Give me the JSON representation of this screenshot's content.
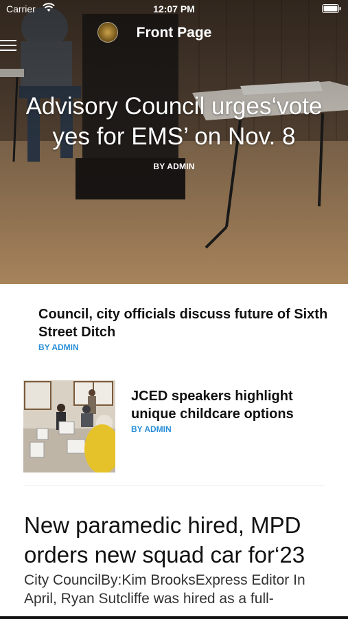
{
  "status_bar": {
    "carrier": "Carrier",
    "time": "12:07 PM"
  },
  "nav": {
    "title": "Front Page"
  },
  "hero": {
    "headline": "Advisory Council urges‘vote yes for EMS’ on Nov. 8",
    "byline": "BY ADMIN"
  },
  "articles": [
    {
      "title": "Council, city officials discuss future of Sixth Street Ditch",
      "byline": "BY ADMIN"
    },
    {
      "title": "JCED speakers highlight unique childcare options",
      "byline": "BY ADMIN"
    },
    {
      "title": "New paramedic hired, MPD orders new squad car for‘23",
      "excerpt": "City CouncilBy:Kim BrooksExpress Editor In April, Ryan Sutcliffe was hired as a full-"
    }
  ],
  "colors": {
    "byline_accent": "#2a8fd8",
    "text": "#111111"
  }
}
